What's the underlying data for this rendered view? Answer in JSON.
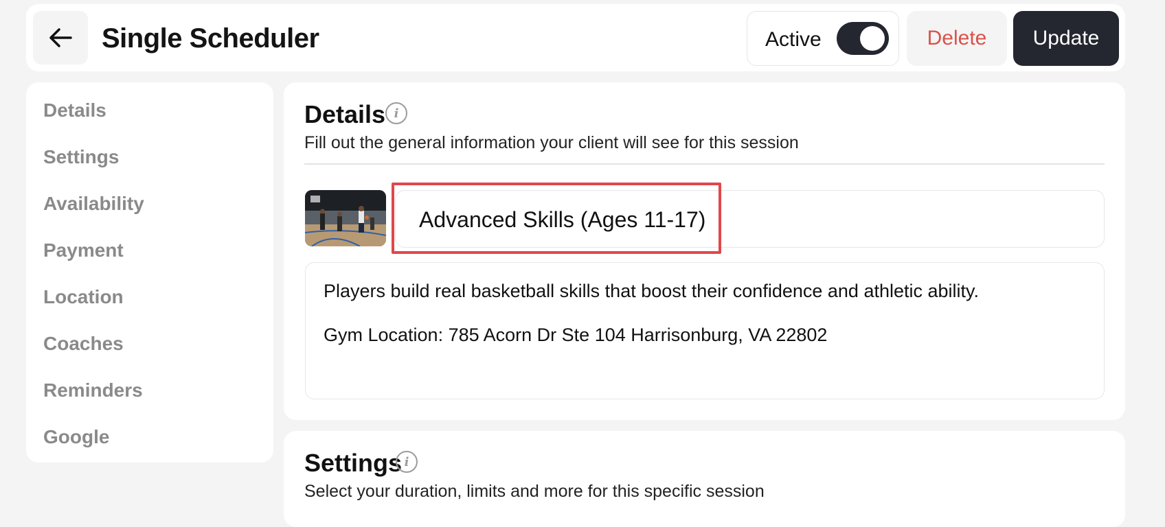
{
  "header": {
    "title": "Single Scheduler",
    "active_label": "Active",
    "active_on": true,
    "delete_label": "Delete",
    "update_label": "Update",
    "back_icon": "arrow-left-icon"
  },
  "sidebar": {
    "items": [
      {
        "label": "Details"
      },
      {
        "label": "Settings"
      },
      {
        "label": "Availability"
      },
      {
        "label": "Payment"
      },
      {
        "label": "Location"
      },
      {
        "label": "Coaches"
      },
      {
        "label": "Reminders"
      },
      {
        "label": "Google"
      }
    ]
  },
  "details": {
    "title": "Details",
    "subtitle": "Fill out the general information your client will see for this session",
    "session_name": "Advanced Skills (Ages 11-17)",
    "description_lines": [
      "Players build real basketball skills that boost their confidence and athletic ability.",
      "Gym Location: 785 Acorn Dr Ste 104 Harrisonburg, VA 22802"
    ]
  },
  "settings": {
    "title": "Settings",
    "subtitle": "Select your duration, limits and more for this specific session"
  },
  "colors": {
    "dark": "#24272f",
    "delete_red": "#d9534a",
    "highlight_red": "#e0474a"
  }
}
